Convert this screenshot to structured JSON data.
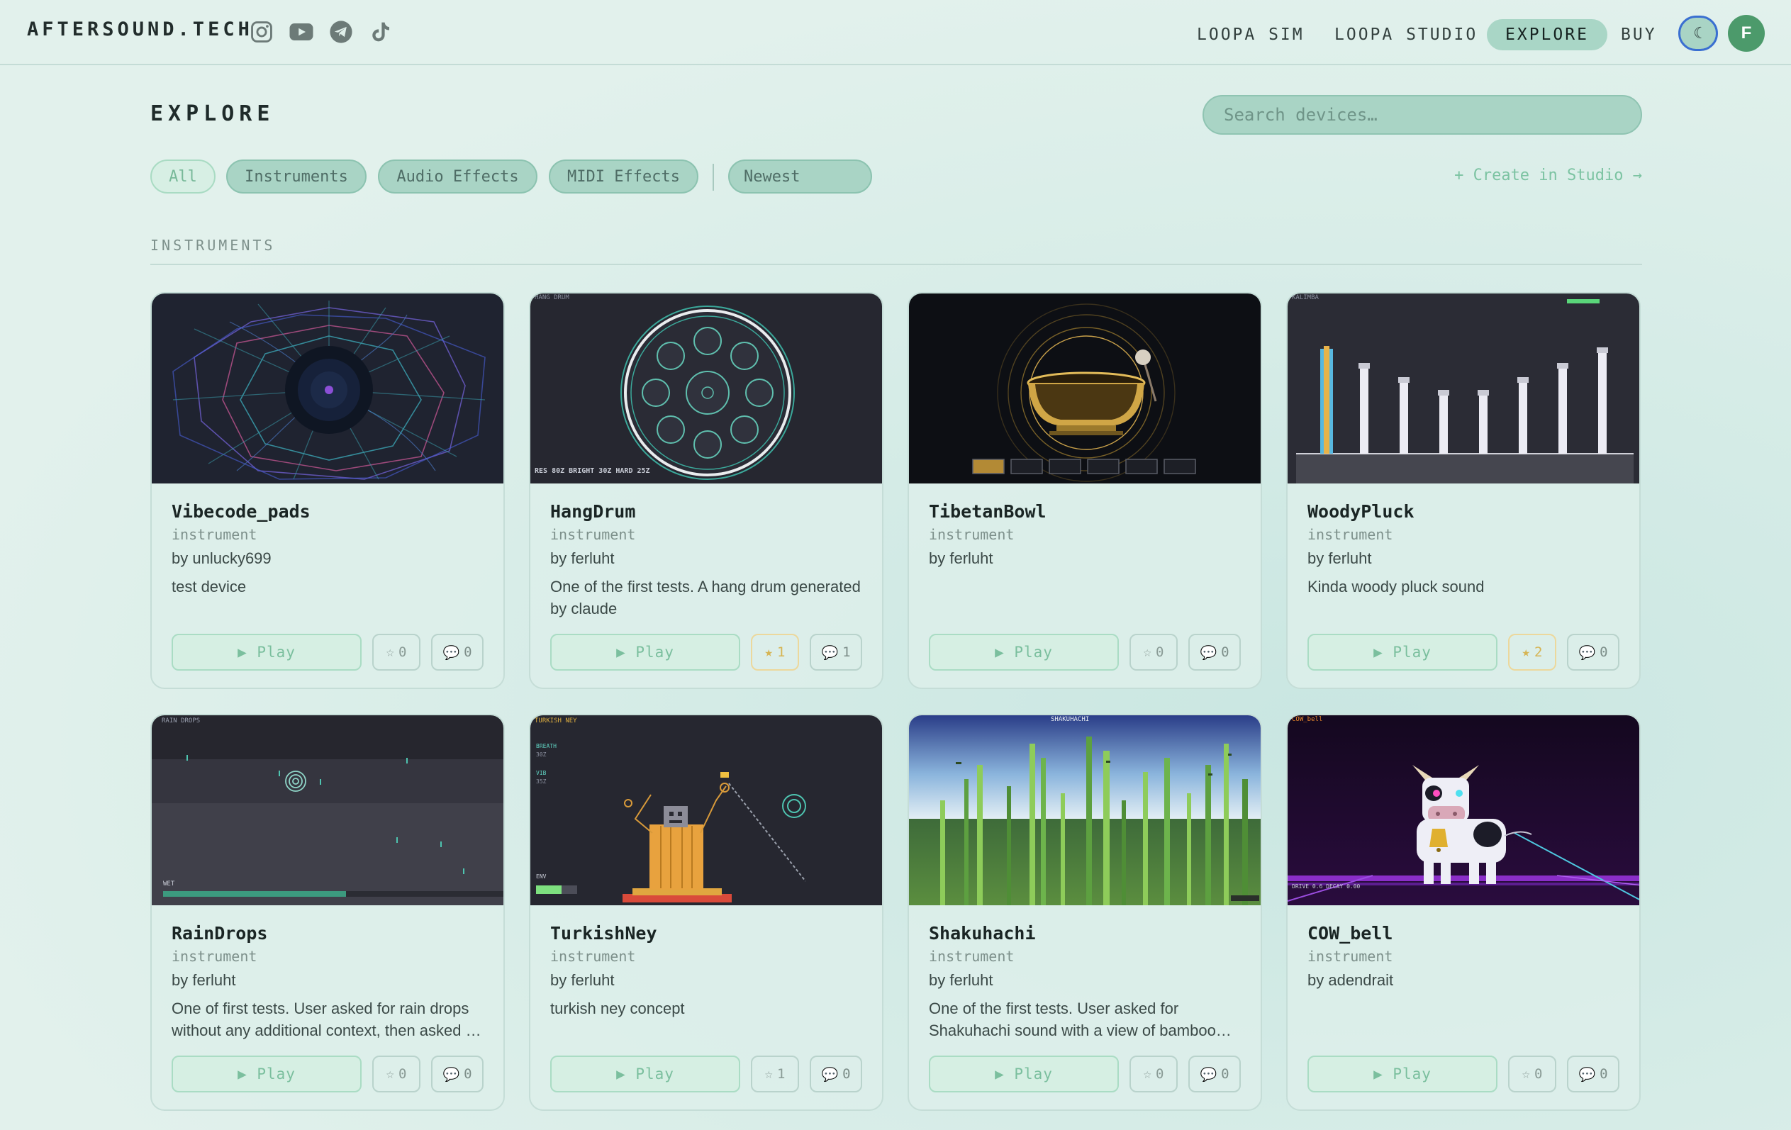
{
  "header": {
    "brand": "AFTERSOUND.TECH",
    "social_icons": [
      "instagram-icon",
      "youtube-icon",
      "telegram-icon",
      "tiktok-icon"
    ],
    "nav": [
      {
        "label": "LOOPA SIM",
        "active": false
      },
      {
        "label": "LOOPA STUDIO",
        "active": false
      },
      {
        "label": "EXPLORE",
        "active": true
      },
      {
        "label": "BUY",
        "active": false
      }
    ],
    "theme_toggle_icon": "☾",
    "avatar_initial": "F"
  },
  "page": {
    "title": "EXPLORE",
    "search_placeholder": "Search devices…"
  },
  "filters": {
    "chips": [
      {
        "label": "All",
        "active": true
      },
      {
        "label": "Instruments",
        "active": false
      },
      {
        "label": "Audio Effects",
        "active": false
      },
      {
        "label": "MIDI Effects",
        "active": false
      }
    ],
    "sort_selected": "Newest",
    "create_link": "+ Create in Studio →"
  },
  "section": {
    "label": "INSTRUMENTS"
  },
  "buttons": {
    "play_label": "▶ Play",
    "star_icon": "☆",
    "starred_icon": "★",
    "comment_icon": "💬"
  },
  "cards": [
    {
      "title": "Vibecode_pads",
      "type": "instrument",
      "author": "by unlucky699",
      "description": "test device",
      "stars": "0",
      "starred": false,
      "comments": "0"
    },
    {
      "title": "HangDrum",
      "type": "instrument",
      "author": "by ferluht",
      "description": "One of the first tests. A hang drum generated by claude",
      "stars": "1",
      "starred": true,
      "comments": "1",
      "thumb_label": "HANG DRUM",
      "thumb_caption": "RES 80Z BRIGHT 30Z HARD 25Z"
    },
    {
      "title": "TibetanBowl",
      "type": "instrument",
      "author": "by ferluht",
      "description": "",
      "stars": "0",
      "starred": false,
      "comments": "0"
    },
    {
      "title": "WoodyPluck",
      "type": "instrument",
      "author": "by ferluht",
      "description": "Kinda woody pluck sound",
      "stars": "2",
      "starred": true,
      "comments": "0",
      "thumb_label": "KALIMBA"
    },
    {
      "title": "RainDrops",
      "type": "instrument",
      "author": "by ferluht",
      "description": "One of first tests. User asked for rain drops without any additional context, then asked …",
      "stars": "0",
      "starred": false,
      "comments": "0",
      "thumb_label": "RAIN DROPS",
      "thumb_caption": "WET"
    },
    {
      "title": "TurkishNey",
      "type": "instrument",
      "author": "by ferluht",
      "description": "turkish ney concept",
      "stars": "1",
      "starred": false,
      "comments": "0",
      "thumb_label": "TURKISH NEY",
      "thumb_breath": "BREATH",
      "thumb_breath_val": "30Z",
      "thumb_vib": "VIB",
      "thumb_vib_val": "35Z",
      "thumb_env": "ENV"
    },
    {
      "title": "Shakuhachi",
      "type": "instrument",
      "author": "by ferluht",
      "description": "One of the first tests. User asked for Shakuhachi sound with a view of bamboo…",
      "stars": "0",
      "starred": false,
      "comments": "0",
      "thumb_label": "SHAKUHACHI"
    },
    {
      "title": "COW_bell",
      "type": "instrument",
      "author": "by adendrait",
      "description": "",
      "stars": "0",
      "starred": false,
      "comments": "0",
      "thumb_label": "COW_bell",
      "thumb_caption": "DRIVE 0.6 DECAY 0.00"
    }
  ]
}
